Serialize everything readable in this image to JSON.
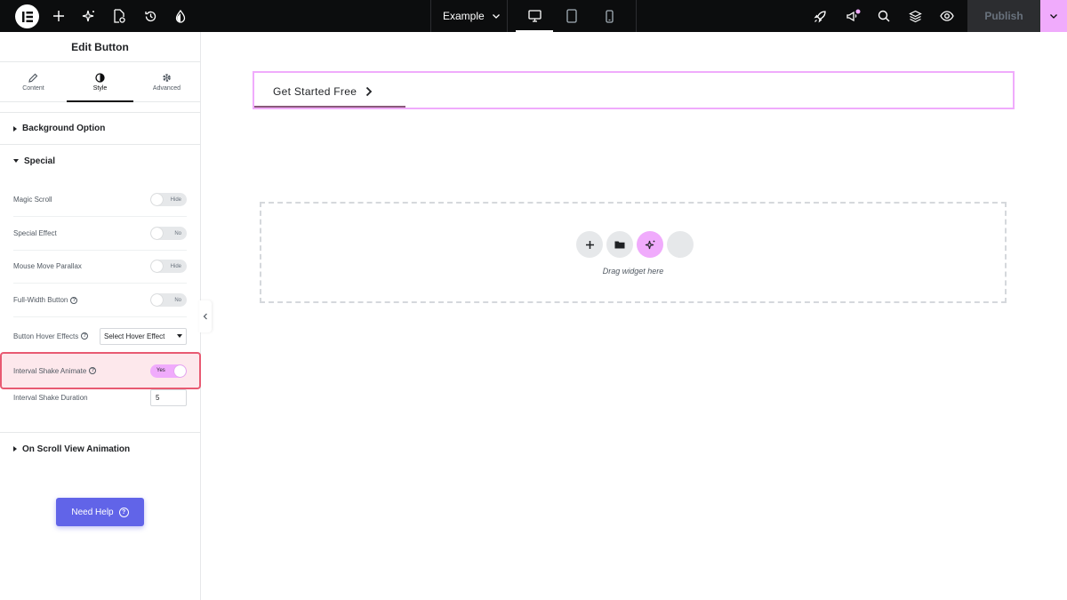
{
  "topbar": {
    "doc_title": "Example",
    "publish_label": "Publish",
    "icons": [
      "elementor-logo-icon",
      "plus-icon",
      "sparkle-icon",
      "page-settings-icon",
      "history-icon",
      "site-style-icon",
      "desktop-icon",
      "tablet-icon",
      "mobile-icon",
      "rocket-icon",
      "notifications-icon",
      "search-icon",
      "structure-icon",
      "preview-eye-icon",
      "chevron-down-icon"
    ],
    "active_device": "desktop"
  },
  "panel": {
    "title": "Edit Button",
    "tabs": [
      {
        "label": "Content",
        "icon": "pencil-icon"
      },
      {
        "label": "Style",
        "icon": "contrast-icon"
      },
      {
        "label": "Advanced",
        "icon": "gear-icon"
      }
    ],
    "active_tab": "Style",
    "sections": {
      "background": "Background Option",
      "special": "Special",
      "scroll": "On Scroll View Animation"
    },
    "controls": {
      "magic_scroll": {
        "label": "Magic Scroll",
        "value": "Hide"
      },
      "special_effect": {
        "label": "Special Effect",
        "value": "No"
      },
      "mouse_parallax": {
        "label": "Mouse Move Parallax",
        "value": "Hide"
      },
      "full_width": {
        "label": "Full-Width Button",
        "value": "No"
      },
      "hover_effects": {
        "label": "Button Hover Effects",
        "value": "Select Hover Effect"
      },
      "shake_animate": {
        "label": "Interval Shake Animate",
        "value": "Yes"
      },
      "shake_duration": {
        "label": "Interval Shake Duration",
        "value": "5"
      }
    },
    "need_help": "Need Help"
  },
  "canvas": {
    "button_text": "Get Started Free",
    "drop_text": "Drag widget here"
  },
  "colors": {
    "accent": "#f0abfc",
    "help_button": "#6164e8",
    "highlight_border": "#e85a72"
  }
}
